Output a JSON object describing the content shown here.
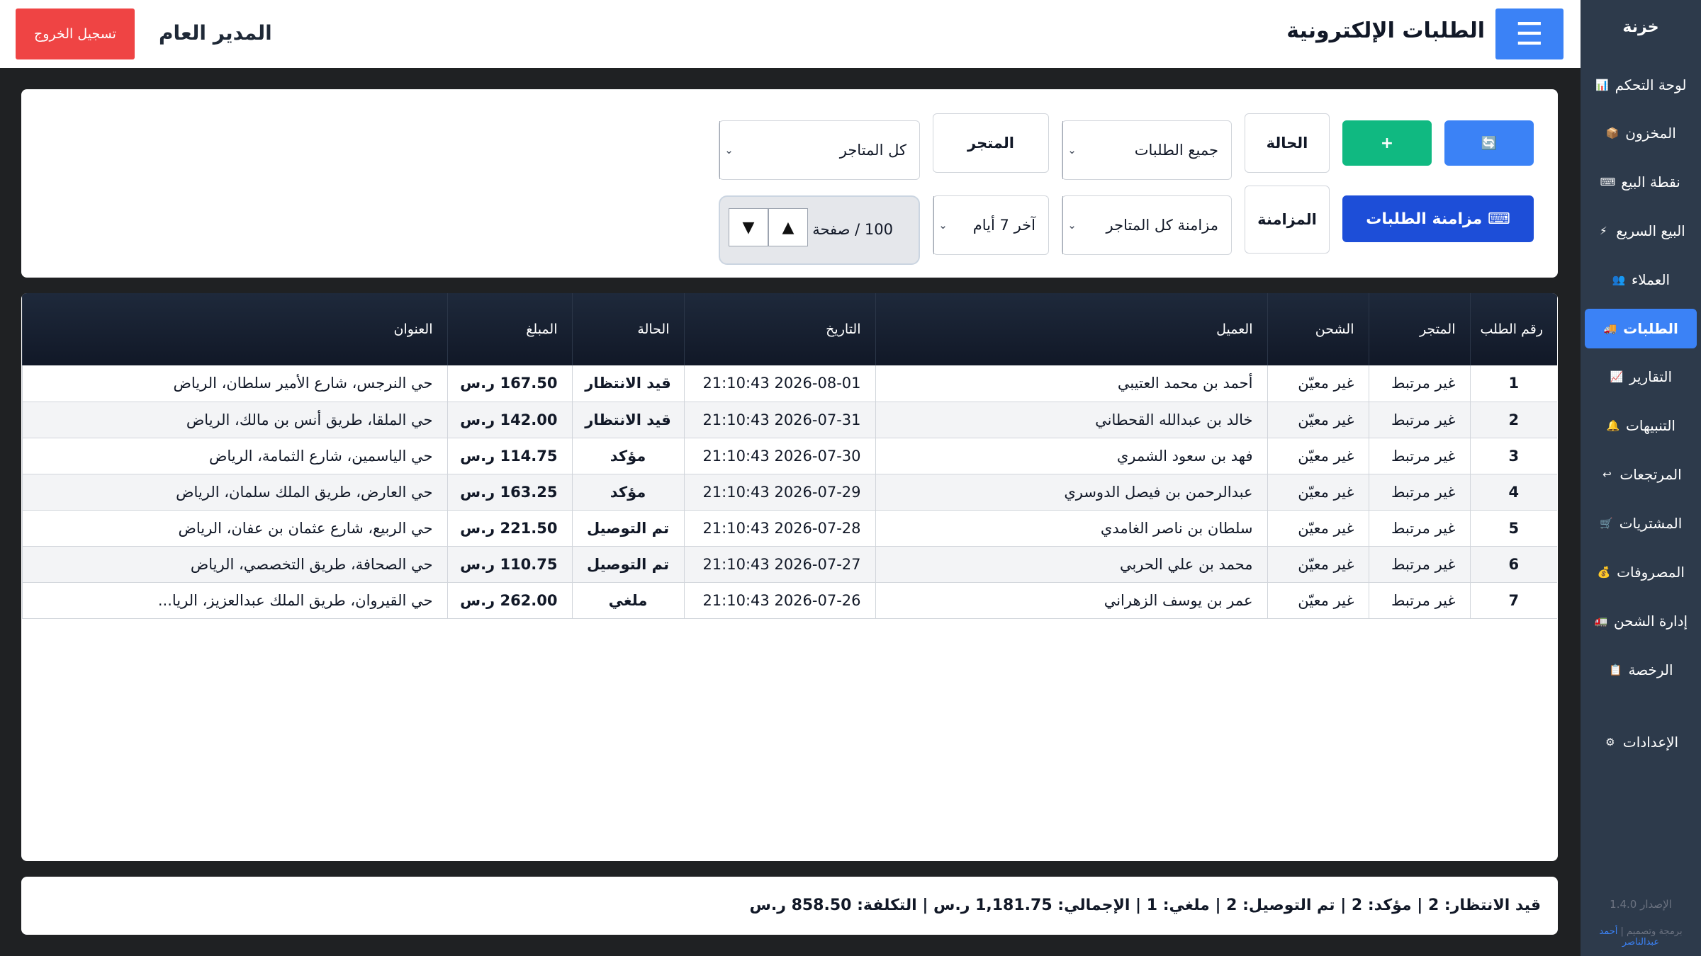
{
  "sidebar": {
    "brand": "خزنة",
    "items": [
      {
        "label": "لوحة التحكم",
        "icon": "📊",
        "active": false
      },
      {
        "label": "المخزون",
        "icon": "📦",
        "active": false
      },
      {
        "label": "نقطة البيع",
        "icon": "⌨",
        "active": false
      },
      {
        "label": "البيع السريع",
        "icon": "⚡",
        "active": false
      },
      {
        "label": "العملاء",
        "icon": "👥",
        "active": false
      },
      {
        "label": "الطلبات",
        "icon": "🚚",
        "active": true
      },
      {
        "label": "التقارير",
        "icon": "📈",
        "active": false
      },
      {
        "label": "التنبيهات",
        "icon": "🔔",
        "active": false
      },
      {
        "label": "المرتجعات",
        "icon": "↩",
        "active": false
      },
      {
        "label": "المشتريات",
        "icon": "🛒",
        "active": false
      },
      {
        "label": "المصروفات",
        "icon": "💰",
        "active": false
      },
      {
        "label": "إدارة الشحن",
        "icon": "🚛",
        "active": false
      },
      {
        "label": "الرخصة",
        "icon": "📋",
        "active": false
      },
      {
        "label": "الإعدادات",
        "icon": "⚙",
        "active": false
      }
    ],
    "version": "الإصدار 1.4.0",
    "credit_prefix": "برمجة وتصميم |",
    "credit_author": "أحمد عبدالناصر"
  },
  "header": {
    "menu_icon": "☰",
    "title": "الطلبات الإلكترونية",
    "user": "المدير العام",
    "logout": "تسجيل الخروج"
  },
  "filters": {
    "refresh_icon": "🔄",
    "add_label": "+",
    "sync_label": "⌨ مزامنة الطلبات",
    "status_label": "الحالة",
    "status_value": "جميع الطلبات",
    "store_label": "المتجر",
    "store_value": "كل المتاجر",
    "sync_label2": "المزامنة",
    "sync_value": "مزامنة كل المتاجر",
    "range_value": "آخر 7 أيام",
    "pager_text": "100 / صفحة",
    "arrow": "⌄"
  },
  "table": {
    "columns": [
      "رقم الطلب",
      "المتجر",
      "الشحن",
      "العميل",
      "التاريخ",
      "الحالة",
      "المبلغ",
      "العنوان"
    ],
    "rows": [
      {
        "id": "1",
        "store": "غير مرتبط",
        "shipping": "غير معيّن",
        "customer": "أحمد بن محمد العتيبي",
        "date": "2026-08-01 21:10:43",
        "status": "قيد الانتظار",
        "amount": "167.50 ر.س",
        "address": "حي النرجس، شارع الأمير سلطان، الرياض"
      },
      {
        "id": "2",
        "store": "غير مرتبط",
        "shipping": "غير معيّن",
        "customer": "خالد بن عبدالله القحطاني",
        "date": "2026-07-31 21:10:43",
        "status": "قيد الانتظار",
        "amount": "142.00 ر.س",
        "address": "حي الملقا، طريق أنس بن مالك، الرياض"
      },
      {
        "id": "3",
        "store": "غير مرتبط",
        "shipping": "غير معيّن",
        "customer": "فهد بن سعود الشمري",
        "date": "2026-07-30 21:10:43",
        "status": "مؤكد",
        "amount": "114.75 ر.س",
        "address": "حي الياسمين، شارع الثمامة، الرياض"
      },
      {
        "id": "4",
        "store": "غير مرتبط",
        "shipping": "غير معيّن",
        "customer": "عبدالرحمن بن فيصل الدوسري",
        "date": "2026-07-29 21:10:43",
        "status": "مؤكد",
        "amount": "163.25 ر.س",
        "address": "حي العارض، طريق الملك سلمان، الرياض"
      },
      {
        "id": "5",
        "store": "غير مرتبط",
        "shipping": "غير معيّن",
        "customer": "سلطان بن ناصر الغامدي",
        "date": "2026-07-28 21:10:43",
        "status": "تم التوصيل",
        "amount": "221.50 ر.س",
        "address": "حي الربيع، شارع عثمان بن عفان، الرياض"
      },
      {
        "id": "6",
        "store": "غير مرتبط",
        "shipping": "غير معيّن",
        "customer": "محمد بن علي الحربي",
        "date": "2026-07-27 21:10:43",
        "status": "تم التوصيل",
        "amount": "110.75 ر.س",
        "address": "حي الصحافة، طريق التخصصي، الرياض"
      },
      {
        "id": "7",
        "store": "غير مرتبط",
        "shipping": "غير معيّن",
        "customer": "عمر بن يوسف الزهراني",
        "date": "2026-07-26 21:10:43",
        "status": "ملغي",
        "amount": "262.00 ر.س",
        "address": "حي القيروان، طريق الملك عبدالعزيز، الريا..."
      }
    ]
  },
  "summary": "قيد الانتظار: 2 | مؤكد: 2 | تم التوصيل: 2 | ملغي: 1 | الإجمالي: 1,181.75 ر.س | التكلفة: 858.50 ر.س",
  "colors": {
    "accent": "#3b82f6",
    "success": "#10b981",
    "danger": "#ef4444",
    "primary_dark": "#1d4ed8"
  }
}
